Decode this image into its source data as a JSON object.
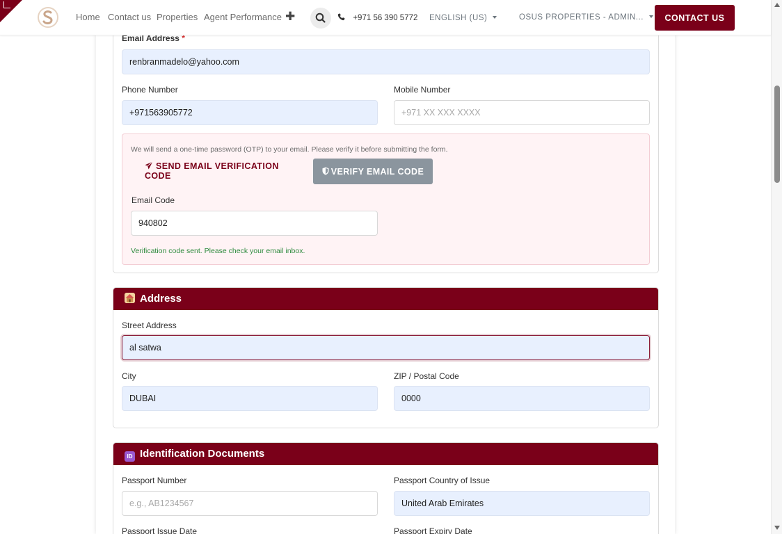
{
  "navbar": {
    "links": [
      "Home",
      "Contact us",
      "Properties",
      "Agent Performance"
    ],
    "phone": "+971 56 390 5772",
    "language": "ENGLISH (US)",
    "account": "OSUS PROPERTIES - ADMIN...",
    "contact_button": "CONTACT US",
    "icons": [
      "plus-icon",
      "search-icon",
      "phone-icon",
      "caret-down-icon"
    ]
  },
  "contact_section": {
    "email_label": "Email Address",
    "email_required": "*",
    "email_value": "renbranmadelo@yahoo.com",
    "phone_label": "Phone Number",
    "phone_value": "+971563905772",
    "mobile_label": "Mobile Number",
    "mobile_placeholder": "+971 XX XXX XXXX",
    "otp_note": "We will send a one-time password (OTP) to your email. Please verify it before submitting the form.",
    "send_code_button": "SEND EMAIL VERIFICATION CODE",
    "verify_button": "VERIFY EMAIL CODE",
    "email_code_label": "Email Code",
    "email_code_value": "940802",
    "verification_message": "Verification code sent. Please check your email inbox."
  },
  "address_section": {
    "title": "Address",
    "street_label": "Street Address",
    "street_value": "al satwa",
    "city_label": "City",
    "city_value": "DUBAI",
    "zip_label": "ZIP / Postal Code",
    "zip_value": "0000"
  },
  "id_section": {
    "title": "Identification Documents",
    "passport_number_label": "Passport Number",
    "passport_number_placeholder": "e.g., AB1234567",
    "passport_country_label": "Passport Country of Issue",
    "passport_country_value": "United Arab Emirates",
    "passport_issue_label": "Passport Issue Date",
    "passport_expiry_label": "Passport Expiry Date"
  },
  "colors": {
    "brand": "#7a0019",
    "autofill_bg": "#e8f0fe",
    "otp_bg": "#fff3f5",
    "success": "#2e8b3e",
    "disabled_button": "#8b959e"
  }
}
